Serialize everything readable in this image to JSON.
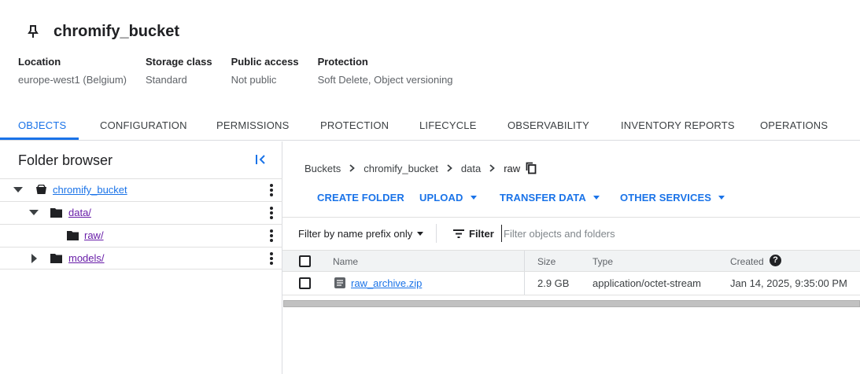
{
  "bucket": {
    "name": "chromify_bucket",
    "properties": [
      {
        "label": "Location",
        "value": "europe-west1 (Belgium)"
      },
      {
        "label": "Storage class",
        "value": "Standard"
      },
      {
        "label": "Public access",
        "value": "Not public"
      },
      {
        "label": "Protection",
        "value": "Soft Delete, Object versioning"
      }
    ]
  },
  "tabs": [
    {
      "label": "OBJECTS",
      "active": true
    },
    {
      "label": "CONFIGURATION"
    },
    {
      "label": "PERMISSIONS"
    },
    {
      "label": "PROTECTION"
    },
    {
      "label": "LIFECYCLE"
    },
    {
      "label": "OBSERVABILITY"
    },
    {
      "label": "INVENTORY REPORTS"
    },
    {
      "label": "OPERATIONS"
    }
  ],
  "folder_browser": {
    "title": "Folder browser",
    "tree": [
      {
        "label": "chromify_bucket",
        "icon": "bucket-icon",
        "expanded": true
      },
      {
        "label": "data/",
        "icon": "folder-icon",
        "expanded": true
      },
      {
        "label": "raw/",
        "icon": "folder-icon"
      },
      {
        "label": "models/",
        "icon": "folder-icon",
        "expanded": false
      }
    ]
  },
  "breadcrumb": [
    "Buckets",
    "chromify_bucket",
    "data",
    "raw"
  ],
  "actions": [
    {
      "label": "CREATE FOLDER",
      "dropdown": false
    },
    {
      "label": "UPLOAD",
      "dropdown": true
    },
    {
      "label": "TRANSFER DATA",
      "dropdown": true
    },
    {
      "label": "OTHER SERVICES",
      "dropdown": true
    }
  ],
  "filter": {
    "prefix_label": "Filter by name prefix only",
    "label": "Filter",
    "placeholder": "Filter objects and folders"
  },
  "table": {
    "columns": [
      "Name",
      "Size",
      "Type",
      "Created"
    ],
    "rows": [
      {
        "name": "raw_archive.zip",
        "size": "2.9 GB",
        "type": "application/octet-stream",
        "created": "Jan 14, 2025, 9:35:00 PM"
      }
    ]
  },
  "colors": {
    "accent": "#1a73e8",
    "visited_link": "#681da8",
    "border": "#dadce0"
  }
}
